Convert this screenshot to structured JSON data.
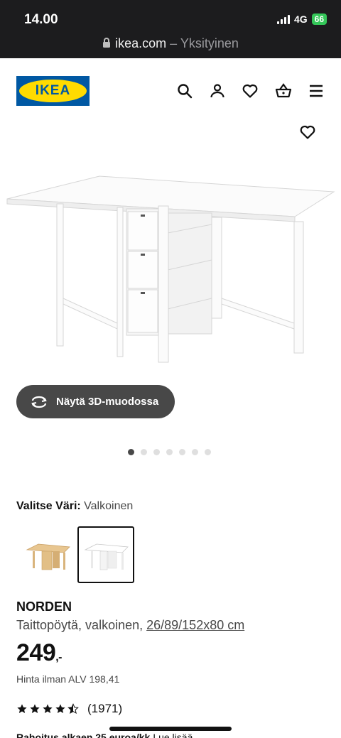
{
  "status_bar": {
    "time": "14.00",
    "network": "4G",
    "battery": "66"
  },
  "browser": {
    "domain": "ikea.com",
    "separator": "–",
    "mode": "Yksityinen"
  },
  "header": {
    "logo_text": "IKEA",
    "icons": [
      "search-icon",
      "user-icon",
      "heart-icon",
      "basket-icon",
      "menu-icon"
    ]
  },
  "viewer": {
    "button_label": "Näytä 3D-muodossa",
    "carousel": {
      "count": 7,
      "active": 1
    }
  },
  "color_picker": {
    "label": "Valitse Väri:",
    "selected": "Valkoinen"
  },
  "product": {
    "name": "NORDEN",
    "type": "Taittopöytä, valkoinen, ",
    "dimensions": "26/89/152x80 cm",
    "price": "249",
    "price_suffix": ",-",
    "vat_text": "Hinta ilman ALV 198,41",
    "rating_value": 4.5,
    "rating_count": "(1971)"
  },
  "financing": {
    "text": "Rahoitus alkaen 25 euroa/kk",
    "link": "Lue lisää"
  },
  "colors": {
    "accent_blue": "#0058a3",
    "logo_yellow": "#ffdb00",
    "dark": "#484848"
  }
}
